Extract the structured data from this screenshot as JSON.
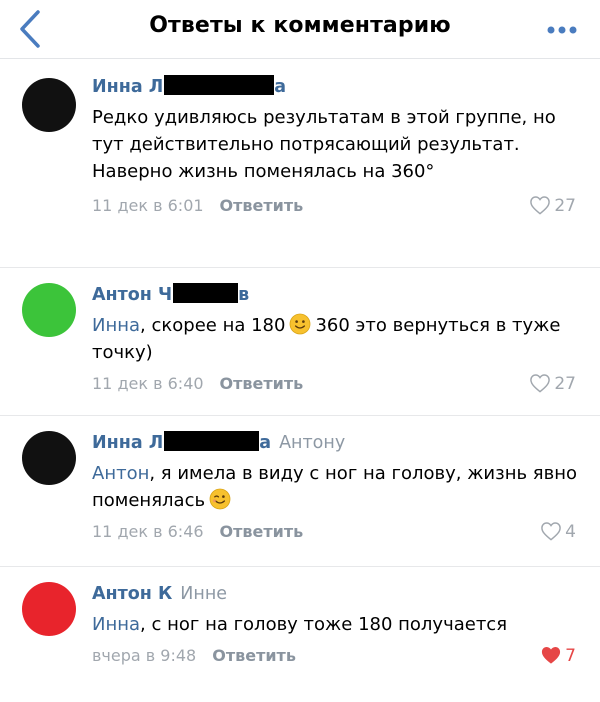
{
  "header": {
    "title": "Ответы к комментарию"
  },
  "comments": [
    {
      "author_first": "Инна Л",
      "author_tail": "а",
      "text": "Редко удивляюсь результатам в этой группе, но тут действительно потрясающий результат. Наверно жизнь поменялась на 360°",
      "time": "11 дек в 6:01",
      "reply_label": "Ответить",
      "likes": "27",
      "avatar_color": "#111111"
    },
    {
      "author_first": "Антон Ч",
      "author_tail": "в",
      "mention": "Инна",
      "text_before_emoji": ", скорее на 180",
      "emoji": "slightly-smiling-face",
      "text_after_emoji": "360 это вернуться в туже точку)",
      "time": "11 дек в 6:40",
      "reply_label": "Ответить",
      "likes": "27",
      "avatar_color": "#3cc43a"
    },
    {
      "author_first": "Инна Л",
      "author_tail": "а",
      "reply_to": "Антону",
      "mention": "Антон",
      "text": ", я имела в виду с ног на голову, жизнь явно поменялась",
      "emoji": "winking-face",
      "time": "11 дек в 6:46",
      "reply_label": "Ответить",
      "likes": "4",
      "avatar_color": "#111111"
    },
    {
      "author_first": "Антон К",
      "reply_to": "Инне",
      "mention": "Инна",
      "text": ", с ног на голову тоже 180 получается",
      "time": "вчера в 9:48",
      "reply_label": "Ответить",
      "likes": "7",
      "liked": true,
      "avatar_color": "#e8242c"
    }
  ],
  "colors": {
    "link": "#3e6a9a",
    "liked": "#e64646",
    "meta": "#a1a7ae"
  }
}
